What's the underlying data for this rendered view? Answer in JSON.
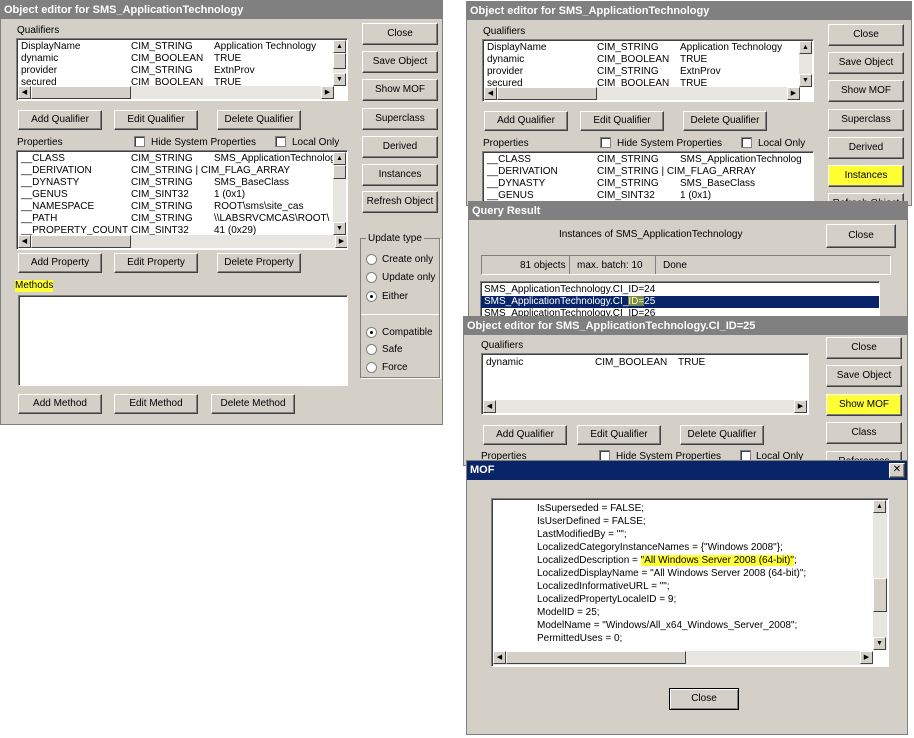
{
  "win1": {
    "title": "Object editor for SMS_ApplicationTechnology",
    "qualifiers_label": "Qualifiers",
    "qualifiers": [
      [
        "DisplayName",
        "CIM_STRING",
        "Application Technology"
      ],
      [
        "dynamic",
        "CIM_BOOLEAN",
        "TRUE"
      ],
      [
        "provider",
        "CIM_STRING",
        "ExtnProv"
      ],
      [
        "secured",
        "CIM_BOOLEAN",
        "TRUE"
      ]
    ],
    "qual_buttons": [
      "Add Qualifier",
      "Edit Qualifier",
      "Delete Qualifier"
    ],
    "properties_label": "Properties",
    "hide_system": "Hide System Properties",
    "local_only": "Local Only",
    "properties": [
      [
        "__CLASS",
        "CIM_STRING",
        "SMS_ApplicationTechnolog"
      ],
      [
        "__DERIVATION",
        "CIM_STRING | CIM_FLAG_ARRAY",
        ""
      ],
      [
        "__DYNASTY",
        "CIM_STRING",
        "SMS_BaseClass"
      ],
      [
        "__GENUS",
        "CIM_SINT32",
        "1 (0x1)"
      ],
      [
        "__NAMESPACE",
        "CIM_STRING",
        "ROOT\\sms\\site_cas"
      ],
      [
        "__PATH",
        "CIM_STRING",
        "\\\\LABSRVCMCAS\\ROOT\\"
      ],
      [
        "__PROPERTY_COUNT",
        "CIM_SINT32",
        "41 (0x29)"
      ]
    ],
    "prop_buttons": [
      "Add Property",
      "Edit Property",
      "Delete Property"
    ],
    "methods_label": "Methods",
    "method_buttons": [
      "Add Method",
      "Edit Method",
      "Delete Method"
    ],
    "side_buttons": [
      "Close",
      "Save Object",
      "Show MOF",
      "Superclass",
      "Derived",
      "Instances",
      "Refresh Object"
    ],
    "update_type_label": "Update type",
    "update_options": [
      "Create only",
      "Update only",
      "Either"
    ],
    "update_selected": "Either",
    "mode_options": [
      "Compatible",
      "Safe",
      "Force"
    ],
    "mode_selected": "Compatible"
  },
  "win2": {
    "title": "Object editor for SMS_ApplicationTechnology",
    "qualifiers_label": "Qualifiers",
    "qualifiers": [
      [
        "DisplayName",
        "CIM_STRING",
        "Application Technology"
      ],
      [
        "dynamic",
        "CIM_BOOLEAN",
        "TRUE"
      ],
      [
        "provider",
        "CIM_STRING",
        "ExtnProv"
      ],
      [
        "secured",
        "CIM_BOOLEAN",
        "TRUE"
      ]
    ],
    "qual_buttons": [
      "Add Qualifier",
      "Edit Qualifier",
      "Delete Qualifier"
    ],
    "properties_label": "Properties",
    "hide_system": "Hide System Properties",
    "local_only": "Local Only",
    "properties": [
      [
        "__CLASS",
        "CIM_STRING",
        "SMS_ApplicationTechnolog"
      ],
      [
        "__DERIVATION",
        "CIM_STRING | CIM_FLAG_ARRAY",
        ""
      ],
      [
        "__DYNASTY",
        "CIM_STRING",
        "SMS_BaseClass"
      ],
      [
        "__GENUS",
        "CIM_SINT32",
        "1 (0x1)"
      ]
    ],
    "side_buttons": [
      "Close",
      "Save Object",
      "Show MOF",
      "Superclass",
      "Derived",
      "Instances",
      "Refresh Object"
    ]
  },
  "query": {
    "title": "Query Result",
    "heading": "Instances of SMS_ApplicationTechnology",
    "close": "Close",
    "count": "81 objects",
    "batch": "max. batch: 10",
    "status": "Done",
    "rows": [
      "SMS_ApplicationTechnology.CI_ID=24",
      "SMS_ApplicationTechnology.CI_ID=25",
      "SMS_ApplicationTechnology.CI_ID=26"
    ],
    "selected_index": 1
  },
  "win3": {
    "title": "Object editor for SMS_ApplicationTechnology.CI_ID=25",
    "qualifiers_label": "Qualifiers",
    "qualifiers": [
      [
        "dynamic",
        "CIM_BOOLEAN",
        "TRUE"
      ]
    ],
    "qual_buttons": [
      "Add Qualifier",
      "Edit Qualifier",
      "Delete Qualifier"
    ],
    "properties_label": "Properties",
    "hide_system": "Hide System Properties",
    "local_only": "Local Only",
    "side_buttons": [
      "Close",
      "Save Object",
      "Show MOF",
      "Class",
      "References"
    ]
  },
  "mof": {
    "title": "MOF",
    "close_glyph": "✕",
    "lines": [
      "IsSuperseded = FALSE;",
      "IsUserDefined = FALSE;",
      "LastModifiedBy = \"\";",
      "LocalizedCategoryInstanceNames = {\"Windows 2008\"};",
      "LocalizedDescription = \"All Windows Server 2008 (64-bit)\";",
      "LocalizedDisplayName = \"All Windows Server 2008 (64-bit)\";",
      "LocalizedInformativeURL = \"\";",
      "LocalizedPropertyLocaleID = 9;",
      "ModelID = 25;",
      "ModelName = \"Windows/All_x64_Windows_Server_2008\";",
      "PermittedUses = 0;"
    ],
    "highlight_index": 4,
    "close_button": "Close"
  },
  "colors": {
    "highlight": "#ffff33",
    "selection": "#0a246a",
    "face": "#d4d0c8"
  }
}
